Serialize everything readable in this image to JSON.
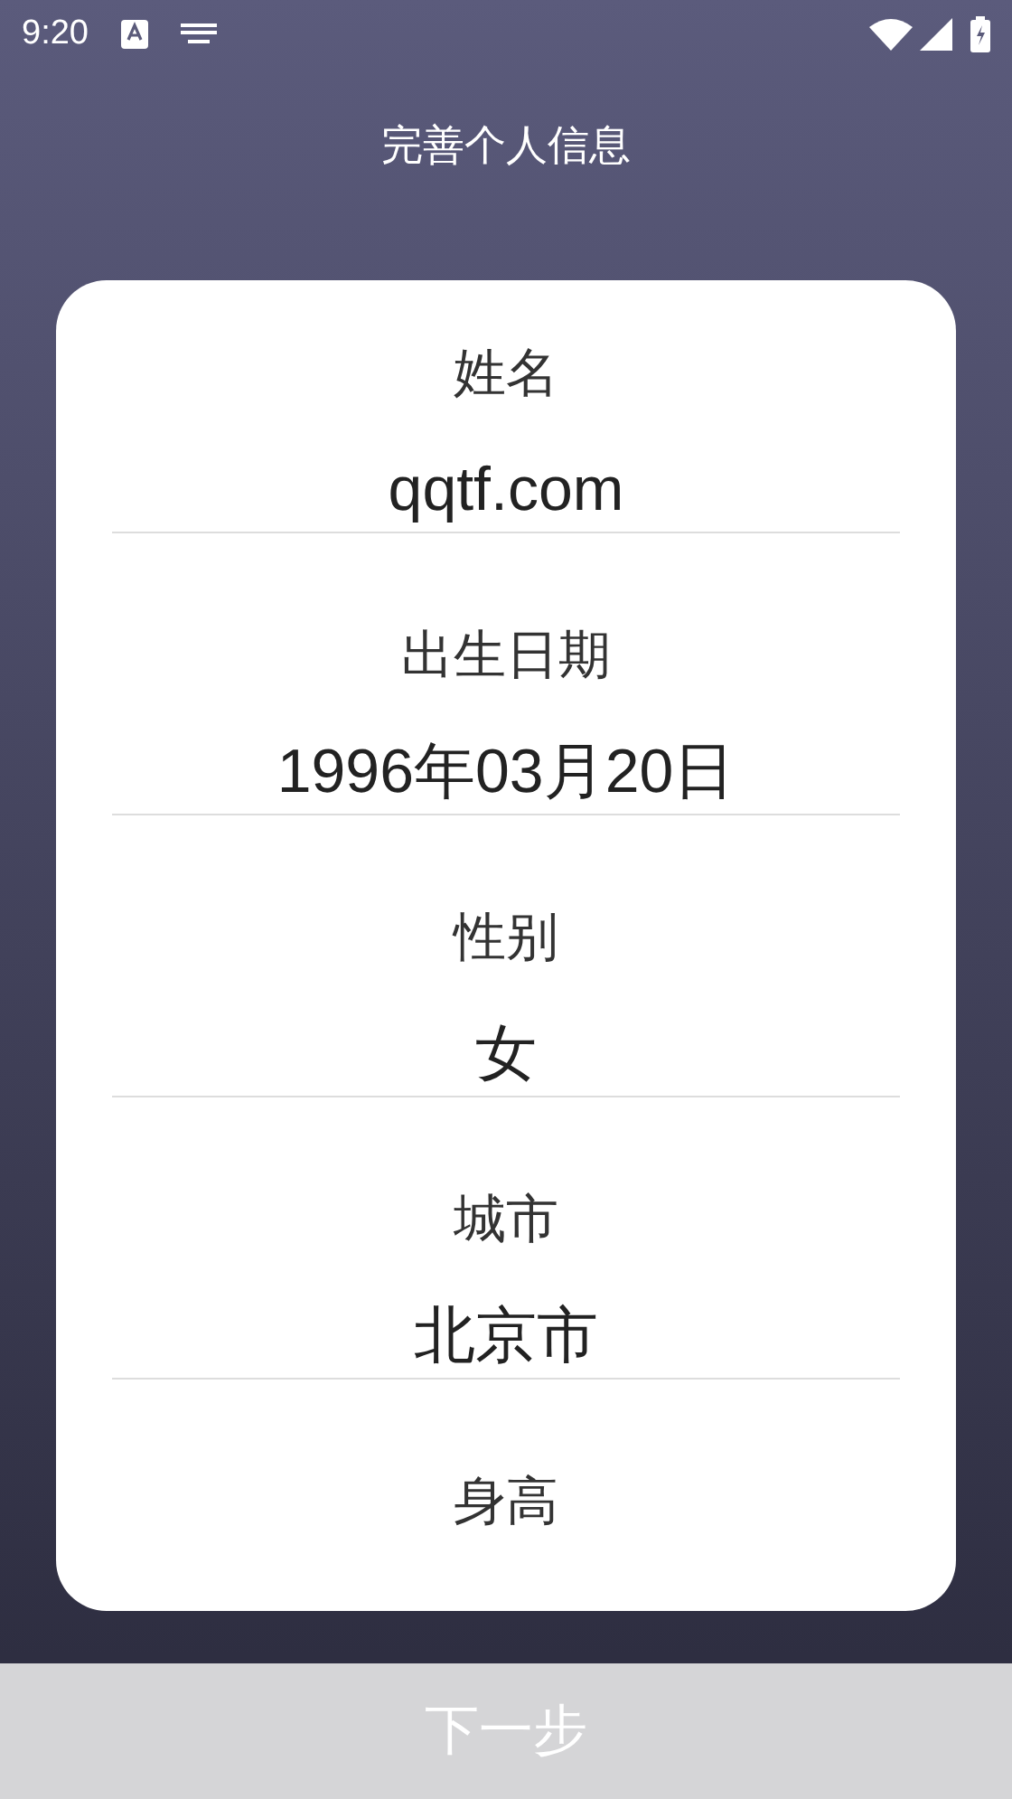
{
  "status_bar": {
    "time": "9:20"
  },
  "title": "完善个人信息",
  "fields": [
    {
      "label": "姓名",
      "value": "qqtf.com"
    },
    {
      "label": "出生日期",
      "value": "1996年03月20日"
    },
    {
      "label": "性别",
      "value": "女"
    },
    {
      "label": "城市",
      "value": "北京市"
    },
    {
      "label": "身高"
    }
  ],
  "next_button": {
    "label": "下一步",
    "disabled": true
  }
}
